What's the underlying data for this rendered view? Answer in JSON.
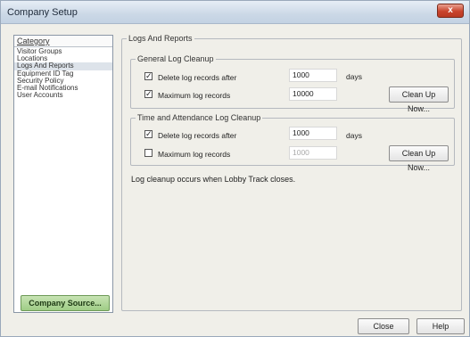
{
  "window": {
    "title": "Company Setup",
    "close_glyph": "x"
  },
  "category_panel": {
    "header": "Category",
    "items": [
      {
        "label": "Visitor Groups"
      },
      {
        "label": "Locations"
      },
      {
        "label": "Logs And Reports",
        "selected": true
      },
      {
        "label": "Equipment ID Tag"
      },
      {
        "label": "Security Policy"
      },
      {
        "label": "E-mail Notifications"
      },
      {
        "label": "User Accounts"
      }
    ],
    "source_button": "Company Source..."
  },
  "main": {
    "group_title": "Logs And Reports",
    "general": {
      "title": "General Log Cleanup",
      "delete_checked": true,
      "delete_label": "Delete log records after",
      "delete_value": "1000",
      "delete_unit": "days",
      "max_checked": true,
      "max_label": "Maximum log records",
      "max_value": "10000",
      "clean_button": "Clean Up Now..."
    },
    "attendance": {
      "title": "Time and Attendance Log Cleanup",
      "delete_checked": true,
      "delete_label": "Delete log records after",
      "delete_value": "1000",
      "delete_unit": "days",
      "max_checked": false,
      "max_label": "Maximum log records",
      "max_value": "1000",
      "clean_button": "Clean Up Now..."
    },
    "note": "Log cleanup occurs when Lobby Track closes."
  },
  "footer": {
    "close_button": "Close",
    "help_button": "Help"
  },
  "checkbox_glyph": "✓"
}
